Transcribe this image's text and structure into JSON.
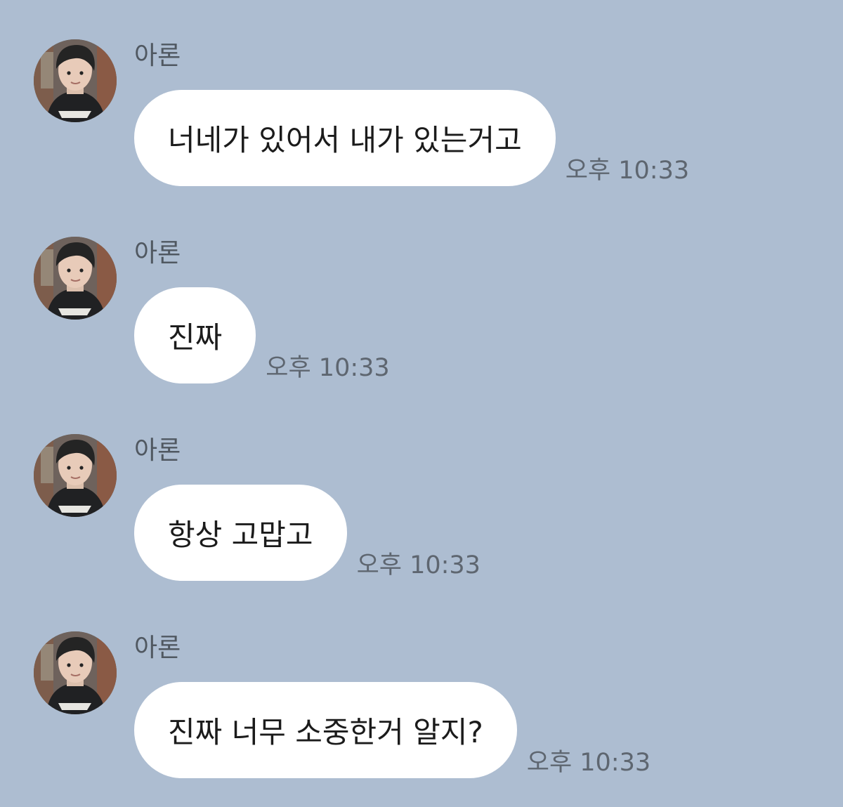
{
  "chat": {
    "messages": [
      {
        "sender": "아론",
        "text": "너네가 있어서 내가 있는거고",
        "time": "오후 10:33",
        "avatar_icon": "profile-photo"
      },
      {
        "sender": "아론",
        "text": "진짜",
        "time": "오후 10:33",
        "avatar_icon": "profile-photo"
      },
      {
        "sender": "아론",
        "text": "항상 고맙고",
        "time": "오후 10:33",
        "avatar_icon": "profile-photo"
      },
      {
        "sender": "아론",
        "text": "진짜 너무 소중한거 알지?",
        "time": "오후 10:33",
        "avatar_icon": "profile-photo"
      }
    ]
  },
  "colors": {
    "background": "#adbdd1",
    "bubble": "#ffffff",
    "text": "#1b1b1b",
    "meta": "#5e6670"
  }
}
